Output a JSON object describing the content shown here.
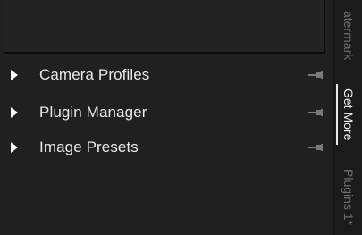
{
  "panel": {
    "items": [
      {
        "label": "Camera Profiles",
        "icon": "pin-icon"
      },
      {
        "label": "Plugin Manager",
        "icon": "pin-icon"
      },
      {
        "label": "Image Presets",
        "icon": "pin-icon"
      }
    ]
  },
  "sidebar": {
    "tabs": [
      {
        "label": "atermark",
        "state": "inactive"
      },
      {
        "label": "Get More",
        "state": "active"
      },
      {
        "label": "Plugins 1*",
        "state": "inactive"
      }
    ]
  },
  "colors": {
    "background": "#202020",
    "text": "#eaeaea",
    "inactive_tab_text": "#6f6f6f",
    "active_tab_text": "#f2f2f2"
  }
}
